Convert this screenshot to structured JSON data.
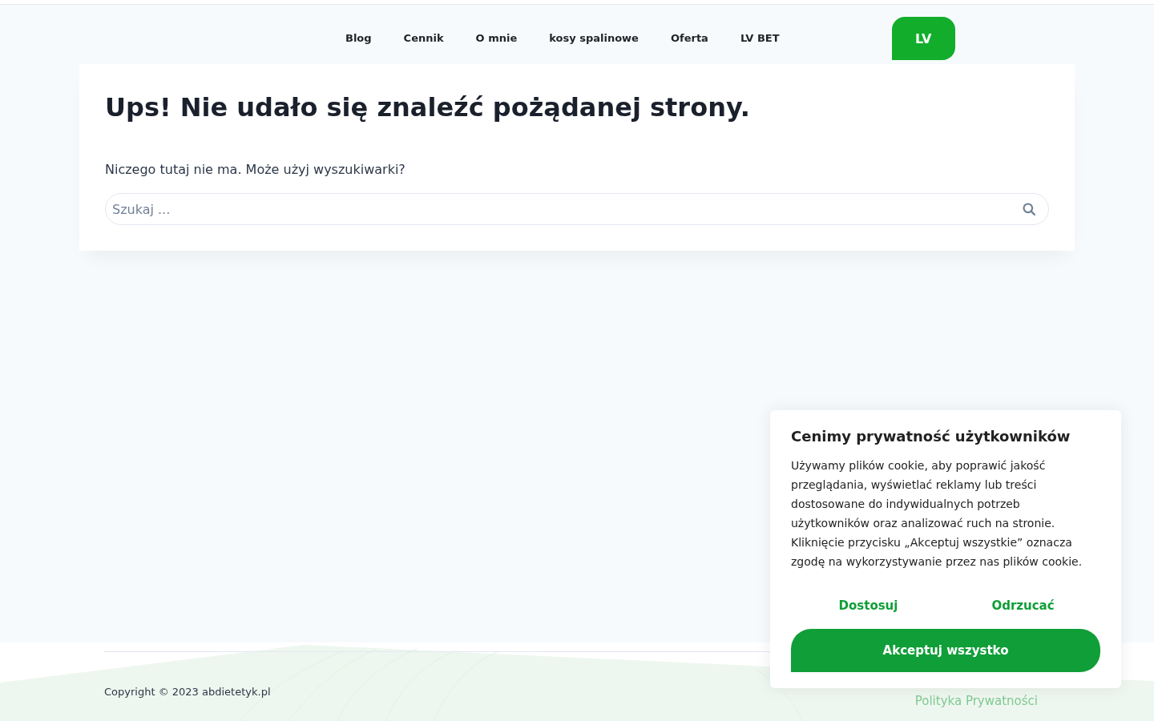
{
  "header": {
    "nav": [
      "Blog",
      "Cennik",
      "O mnie",
      "kosy spalinowe",
      "Oferta",
      "LV BET"
    ],
    "language_button": {
      "label": "LV"
    }
  },
  "error_card": {
    "title": "Ups! Nie udało się znaleźć pożądanej strony.",
    "message": "Niczego tutaj nie ma. Może użyj wyszukiwarki?",
    "search": {
      "placeholder": "Szukaj ..."
    }
  },
  "footer": {
    "copyright": "Copyright © 2023 abdietetyk.pl",
    "links": [
      "Polityka Prywatności"
    ]
  },
  "cookie_banner": {
    "title": "Cenimy prywatność użytkowników",
    "text": "Używamy plików cookie, aby poprawić jakość przeglądania, wyświetlać reklamy lub treści dostosowane do indywidualnych potrzeb użytkowników oraz analizować ruch na stronie. Kliknięcie przycisku „Akceptuj wszystkie” oznacza zgodę na wykorzystywanie przez nas plików cookie.",
    "buttons": [
      {
        "label": "Dostosuj",
        "kind": "link"
      },
      {
        "label": "Odrzucać",
        "kind": "link"
      },
      {
        "label": "Akceptuj wszystko",
        "kind": "primary"
      }
    ]
  }
}
